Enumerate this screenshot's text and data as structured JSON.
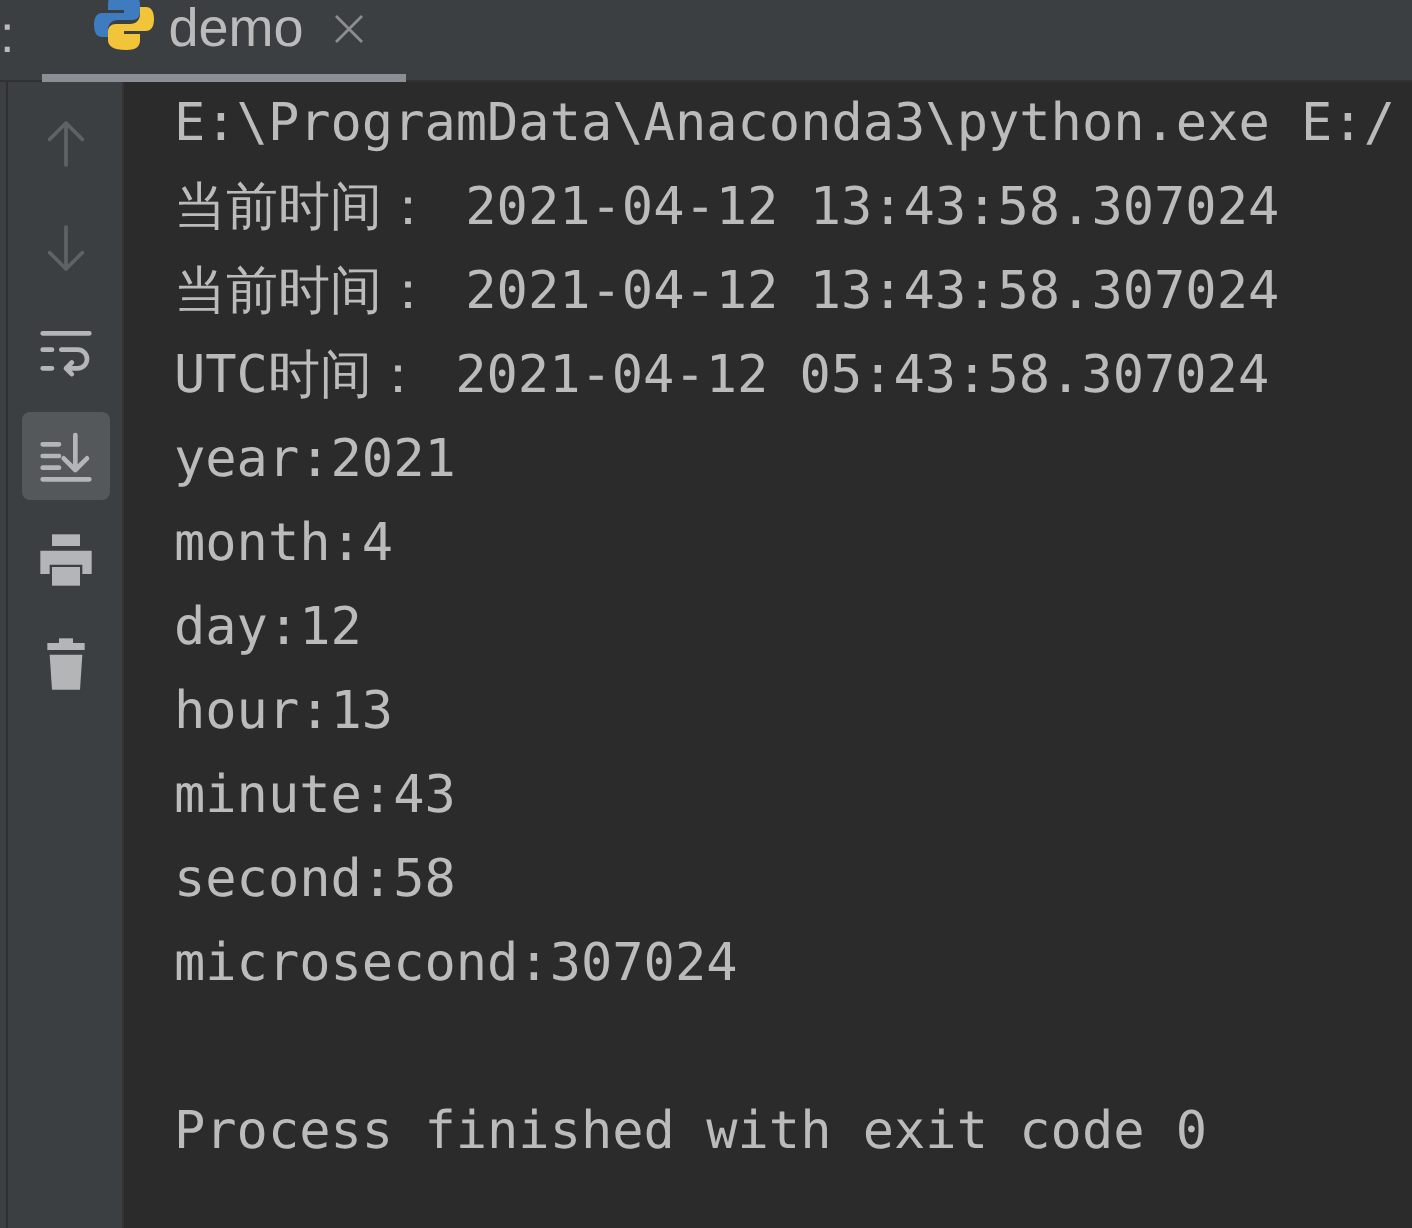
{
  "panel_label": ":",
  "tabs": [
    {
      "label": "demo",
      "selected": true
    }
  ],
  "toolbar": [
    {
      "kind": "up",
      "disabled": true,
      "on": false
    },
    {
      "kind": "down",
      "disabled": true,
      "on": false
    },
    {
      "kind": "wrap",
      "disabled": false,
      "on": false
    },
    {
      "kind": "autoscroll",
      "disabled": false,
      "on": true
    },
    {
      "kind": "print",
      "disabled": false,
      "on": false
    },
    {
      "kind": "clear",
      "disabled": false,
      "on": false
    }
  ],
  "console": {
    "lines": [
      "E:\\ProgramData\\Anaconda3\\python.exe E:/",
      "当前时间： 2021-04-12 13:43:58.307024",
      "当前时间： 2021-04-12 13:43:58.307024",
      "UTC时间： 2021-04-12 05:43:58.307024",
      "year:2021",
      "month:4",
      "day:12",
      "hour:13",
      "minute:43",
      "second:58",
      "microsecond:307024"
    ],
    "exit_message": "Process finished with exit code 0"
  }
}
